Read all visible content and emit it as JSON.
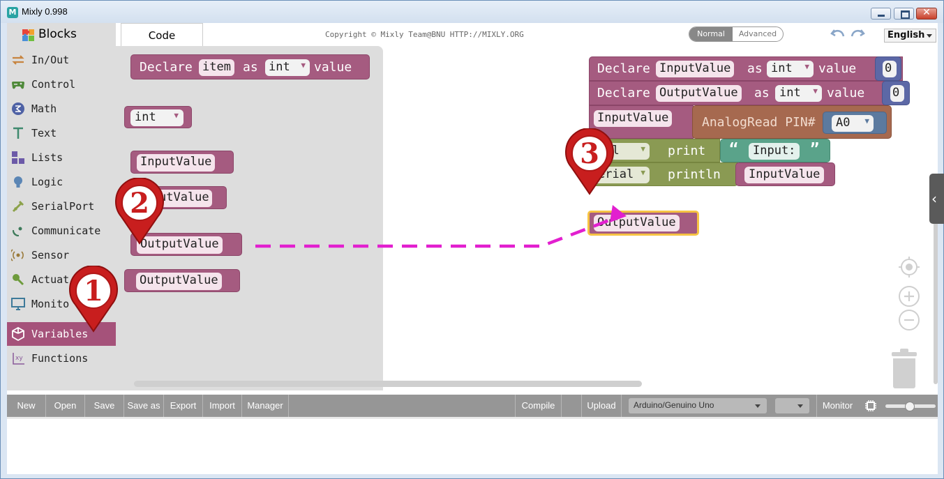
{
  "window": {
    "title": "Mixly 0.998",
    "icon": "mixly-logo-icon"
  },
  "header": {
    "code_tab": "Code",
    "copyright": "Copyright © Mixly Team@BNU HTTP://MIXLY.ORG",
    "mode_normal": "Normal",
    "mode_advanced": "Advanced",
    "language": "English"
  },
  "sidebar": {
    "title": "Blocks",
    "items": [
      {
        "label": "In/Out",
        "icon": "arrows-icon",
        "color": "#c7843f"
      },
      {
        "label": "Control",
        "icon": "gamepad-icon",
        "color": "#4f8a3a"
      },
      {
        "label": "Math",
        "icon": "math-icon",
        "color": "#4f62a5"
      },
      {
        "label": "Text",
        "icon": "text-icon",
        "color": "#3f8a6e"
      },
      {
        "label": "Lists",
        "icon": "lists-icon",
        "color": "#6c5aa8"
      },
      {
        "label": "Logic",
        "icon": "bulb-icon",
        "color": "#5b86b5"
      },
      {
        "label": "SerialPort",
        "icon": "usb-icon",
        "color": "#8ca24a"
      },
      {
        "label": "Communicate",
        "icon": "satellite-icon",
        "color": "#3d7a5a"
      },
      {
        "label": "Sensor",
        "icon": "sensor-icon",
        "color": "#9a7a3a"
      },
      {
        "label": "Actuat",
        "icon": "actuator-icon",
        "color": "#6e9b3c"
      },
      {
        "label": "Monito",
        "icon": "monitor-icon",
        "color": "#3e7a9a"
      },
      {
        "label": "Variables",
        "icon": "unity-icon",
        "color": "#a5527a",
        "selected": true
      },
      {
        "label": "Functions",
        "icon": "function-icon",
        "color": "#8a5a9a"
      }
    ]
  },
  "flyout": {
    "declare": {
      "kw": "Declare",
      "name": "item",
      "kw_as": "as",
      "type": "int",
      "kw_value": "value"
    },
    "type_block": "int",
    "get_input": "InputValue",
    "set_output_partial": "utValue",
    "get_output": "OutputValue",
    "set_output": "OutputValue"
  },
  "canvas": {
    "declare1": {
      "kw": "Declare",
      "name": "InputValue",
      "kw_as": "as",
      "type": "int",
      "kw_value": "value",
      "init": "0"
    },
    "declare2": {
      "kw": "Declare",
      "name": "OutputValue",
      "kw_as": "as",
      "type": "int",
      "kw_value": "value",
      "init": "0"
    },
    "assign": {
      "target": "InputValue",
      "func": "AnalogRead PIN#",
      "pin": "A0"
    },
    "print": {
      "serial": "ial",
      "kw": "print",
      "open_quote": "“",
      "text": "Input:",
      "close_quote": "”"
    },
    "println": {
      "serial": "erial",
      "kw": "println",
      "var": "InputValue"
    },
    "dragged": "OutputValue"
  },
  "markers": [
    "1",
    "2",
    "3"
  ],
  "toolbar": {
    "new": "New",
    "open": "Open",
    "save": "Save",
    "save_as": "Save as",
    "export": "Export",
    "import": "Import",
    "manager": "Manager",
    "compile": "Compile",
    "upload": "Upload",
    "board": "Arduino/Genuino Uno",
    "port": "",
    "monitor": "Monitor"
  },
  "colors": {
    "variable_block": "#a55b80",
    "marker_red": "#c81e1e",
    "arrow_magenta": "#e21fcf",
    "selection_yellow": "#f6c343"
  }
}
